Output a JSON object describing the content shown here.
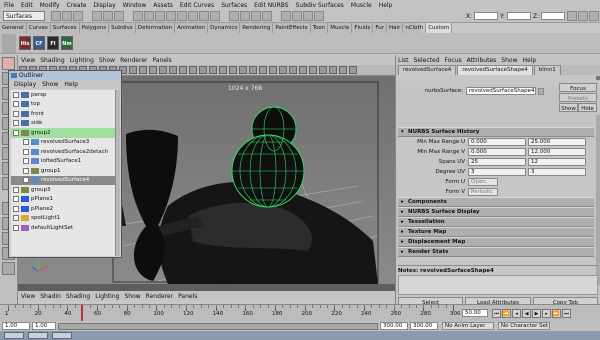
{
  "menubar": [
    "File",
    "Edit",
    "Modify",
    "Create",
    "Display",
    "Window",
    "Assets",
    "Edit Curves",
    "Surfaces",
    "Edit NURBS",
    "Subdiv Surfaces",
    "Muscle",
    "Help"
  ],
  "statusline": {
    "mode": "Surfaces",
    "x_label": "X:",
    "y_label": "Y:",
    "z_label": "Z:"
  },
  "shelf": {
    "tabs": [
      "General",
      "Curves",
      "Surfaces",
      "Polygons",
      "Subdivs",
      "Deformation",
      "Animation",
      "Dynamics",
      "Rendering",
      "PaintEffects",
      "Toon",
      "Muscle",
      "Fluids",
      "Fur",
      "Hair",
      "nCloth",
      "Custom"
    ],
    "icons": [
      "His",
      "CF",
      "FI",
      "Nm"
    ]
  },
  "viewport": {
    "menu": [
      "View",
      "Shading",
      "Lighting",
      "Show",
      "Renderer",
      "Panels"
    ],
    "resolution": "1024 x 768",
    "camera": "persp"
  },
  "outliner": {
    "title": "Outliner",
    "menu": [
      "Display",
      "Show",
      "Help"
    ],
    "items": [
      {
        "label": "persp",
        "indent": 0,
        "kind": "cam"
      },
      {
        "label": "top",
        "indent": 0,
        "kind": "cam"
      },
      {
        "label": "front",
        "indent": 0,
        "kind": "cam"
      },
      {
        "label": "side",
        "indent": 0,
        "kind": "cam"
      },
      {
        "label": "group2",
        "indent": 0,
        "kind": "grp",
        "highlight": true
      },
      {
        "label": "revolvedSurface3",
        "indent": 1,
        "kind": "surf"
      },
      {
        "label": "revolvedSurface2detach",
        "indent": 1,
        "kind": "surf"
      },
      {
        "label": "loftedSurface1",
        "indent": 1,
        "kind": "surf"
      },
      {
        "label": "group1",
        "indent": 1,
        "kind": "grp"
      },
      {
        "label": "revolvedSurface4",
        "indent": 1,
        "kind": "surf",
        "selected": true
      },
      {
        "label": "group3",
        "indent": 0,
        "kind": "grp"
      },
      {
        "label": "pPlane1",
        "indent": 0,
        "kind": "plane"
      },
      {
        "label": "pPlane2",
        "indent": 0,
        "kind": "plane"
      },
      {
        "label": "spotLight1",
        "indent": 0,
        "kind": "light"
      },
      {
        "label": "defaultLightSet",
        "indent": 0,
        "kind": "set"
      }
    ]
  },
  "attribute_editor": {
    "menu": [
      "List",
      "Selected",
      "Focus",
      "Attributes",
      "Show",
      "Help"
    ],
    "tabs": [
      "revolvedSurface4",
      "revolvedSurfaceShape4",
      "blinn1"
    ],
    "node_label": "nurbsSurface:",
    "node_value": "revolvedSurfaceShape4",
    "focus_btn": "Focus",
    "presets_btn": "Presets",
    "show_btn": "Show",
    "hide_btn": "Hide",
    "history_title": "NURBS Surface History",
    "rows": [
      {
        "label": "Min Max Range U",
        "a": "0.000",
        "b": "25.000"
      },
      {
        "label": "Min Max Range V",
        "a": "0.000",
        "b": "12.000"
      },
      {
        "label": "Spans UV",
        "a": "25",
        "b": "12"
      },
      {
        "label": "Degree UV",
        "a": "3",
        "b": "3"
      }
    ],
    "form_u_label": "Form U",
    "form_u": "Open",
    "form_v_label": "Form V",
    "form_v": "Periodic",
    "sections": [
      "Components",
      "NURBS Surface Display",
      "Tessellation",
      "Texture Map",
      "Displacement Map",
      "Render Stats"
    ],
    "notes": "Notes:  revolvedSurfaceShape4",
    "buttons": [
      "Select",
      "Load Attributes",
      "Copy Tab"
    ]
  },
  "bottom_panel_menu": [
    "View",
    "Shadin",
    "Shading",
    "Lighting",
    "Show",
    "Renderer",
    "Panels"
  ],
  "timeline": {
    "ticks": [
      "1",
      "20",
      "40",
      "60",
      "80",
      "100",
      "120",
      "140",
      "160",
      "180",
      "200",
      "220",
      "240",
      "260",
      "280",
      "300"
    ],
    "current": "50.00"
  },
  "range": {
    "start": "1.00",
    "inner_start": "1.00",
    "inner_end": "300.00",
    "end_a": "300.00",
    "end_b": "300.00",
    "anim_layer": "No Anim Layer",
    "char_set": "No Character Set"
  }
}
